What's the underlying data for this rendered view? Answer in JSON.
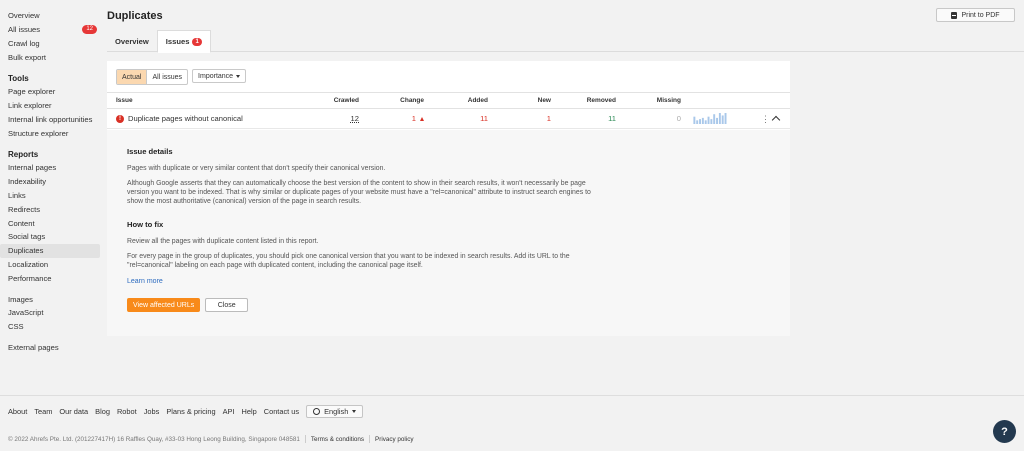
{
  "sidebar": {
    "overview": "Overview",
    "all_issues": "All issues",
    "all_issues_count": "12",
    "crawl_log": "Crawl log",
    "bulk_export": "Bulk export",
    "tools_heading": "Tools",
    "tools": [
      "Page explorer",
      "Link explorer",
      "Internal link opportunities",
      "Structure explorer"
    ],
    "reports_heading": "Reports",
    "reports": [
      "Internal pages",
      "Indexability",
      "Links",
      "Redirects",
      "Content",
      "Social tags",
      "Duplicates",
      "Localization",
      "Performance"
    ],
    "resources": [
      "Images",
      "JavaScript",
      "CSS"
    ],
    "external": "External pages"
  },
  "header": {
    "title": "Duplicates",
    "print_label": "Print to PDF"
  },
  "tabs": {
    "overview": "Overview",
    "issues": "Issues",
    "issues_count": "1"
  },
  "filters": {
    "actual": "Actual",
    "all_issues": "All issues",
    "importance": "Importance"
  },
  "table": {
    "headers": {
      "issue": "Issue",
      "crawled": "Crawled",
      "change": "Change",
      "added": "Added",
      "new": "New",
      "removed": "Removed",
      "missing": "Missing"
    },
    "row": {
      "issue": "Duplicate pages without canonical",
      "crawled": "12",
      "change": "1",
      "added": "11",
      "new": "1",
      "removed": "11",
      "missing": "0",
      "trend": [
        6,
        3,
        4,
        5,
        3,
        6,
        4,
        8,
        5,
        9,
        7,
        9
      ]
    }
  },
  "details": {
    "heading": "Issue details",
    "p1": "Pages with duplicate or very similar content that don't specify their canonical version.",
    "p2": "Although Google asserts that they can automatically choose the best version of the content to show in their search results, it won't necessarily be page version you want to be indexed. That is why similar or duplicate pages of your website must have a \"rel=canonical\" attribute to instruct search engines to show the most authoritative (canonical) version of the page in search results.",
    "fix_heading": "How to fix",
    "fix_p1": "Review all the pages with duplicate content listed in this report.",
    "fix_p2": "For every page in the group of duplicates, you should pick one canonical version that you want to be indexed in search results. Add its URL to the \"rel=canonical\" labeling on each page with duplicated content, including the canonical page itself.",
    "learn_more": "Learn more",
    "view_button": "View affected URLs",
    "close_button": "Close"
  },
  "footer": {
    "links": [
      "About",
      "Team",
      "Our data",
      "Blog",
      "Robot",
      "Jobs",
      "Plans & pricing",
      "API",
      "Help",
      "Contact us"
    ],
    "language": "English",
    "copyright": "© 2022 Ahrefs Pte. Ltd. (201227417H) 16 Raffles Quay, #33-03 Hong Leong Building, Singapore 048581",
    "terms": "Terms & conditions",
    "privacy": "Privacy policy"
  },
  "help_label": "?",
  "colors": {
    "accent_orange": "#f88a1a",
    "badge_red": "#e63737",
    "spark_blue": "#a9c8ea",
    "help_navy": "#23394f"
  }
}
